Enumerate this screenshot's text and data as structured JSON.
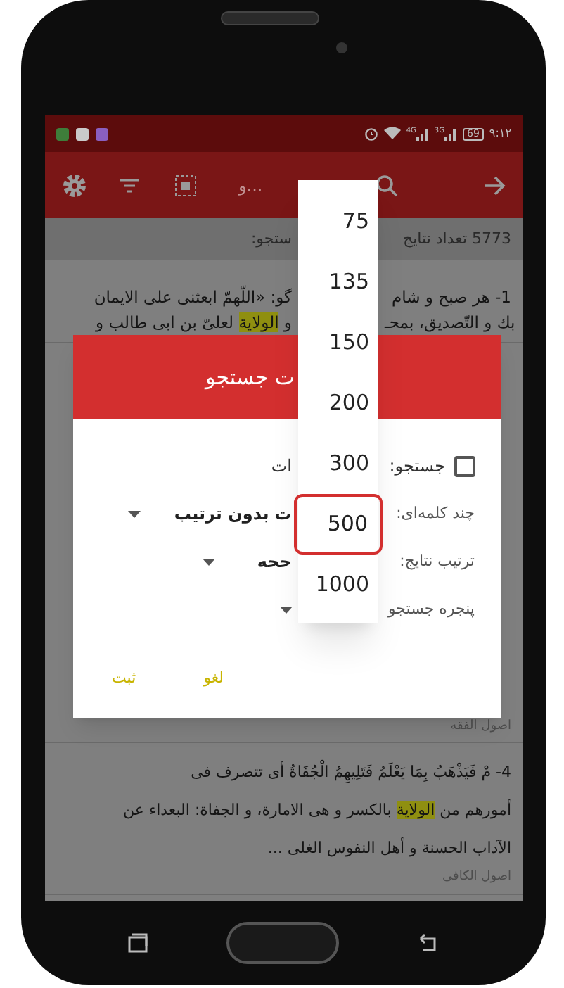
{
  "status_bar": {
    "time": "۹:۱۲",
    "battery": "69",
    "signal_labels": [
      "3G",
      "4G"
    ]
  },
  "toolbar": {
    "search_hint": "و..."
  },
  "results_count": {
    "right": "5773  تعداد نتایج",
    "left": "ستجو:"
  },
  "results": [
    {
      "lines": [
        {
          "right": [
            {
              "text": "1- هر صبح و شام",
              "highlight": false
            }
          ],
          "left": [
            {
              "text": "گو: «اللّهمّ ابعثنی علی الایمان",
              "highlight": false
            }
          ]
        },
        {
          "right": [
            {
              "text": "بك و التّصديق، بمحـ",
              "highlight": false
            }
          ],
          "left": [
            {
              "text": "و ",
              "highlight": false
            },
            {
              "text": "الولاية",
              "highlight": true
            },
            {
              "text": " لعلیّ بن ابی طالب و",
              "highlight": false
            }
          ]
        }
      ]
    },
    {
      "source": "اصول الفقه"
    },
    {
      "lines": [
        {
          "right": [
            {
              "text": "4-  مْ فَيَذْهَبُ بِمَا يَعْلَمُ فَتَلِيهِمُ الْجُفَاةُ     أی تتصرف فی",
              "highlight": false
            }
          ]
        },
        {
          "right": [
            {
              "text": "أمورهم من ",
              "highlight": false
            },
            {
              "text": "الولاية",
              "highlight": true
            },
            {
              "text": " بالكسر و هی الامارة، و الجفاة: البعداء عن",
              "highlight": false
            }
          ]
        },
        {
          "right": [
            {
              "text": "الآداب الحسنة و أهل النفوس الغلی ...",
              "highlight": false
            }
          ]
        }
      ],
      "source": "اصول الكافی"
    }
  ],
  "dialog": {
    "title": "ت جستجو",
    "checkbox": {
      "label_right": "جستجو:",
      "label_left": "ات",
      "checked": false
    },
    "fields": [
      {
        "label": "چند کلمه‌ای:",
        "value": "ت بدون ترتیب"
      },
      {
        "label": "ترتیب نتایج:",
        "value": "ححه"
      },
      {
        "label": "پنجره جستجو"
      }
    ],
    "buttons": [
      "لغو",
      "ثبت"
    ]
  },
  "dropdown": {
    "options": [
      {
        "label": "75",
        "selected": false
      },
      {
        "label": "135",
        "selected": false
      },
      {
        "label": "150",
        "selected": false
      },
      {
        "label": "200",
        "selected": false
      },
      {
        "label": "300",
        "selected": false
      },
      {
        "label": "500",
        "selected": true
      },
      {
        "label": "1000",
        "selected": false
      }
    ]
  }
}
